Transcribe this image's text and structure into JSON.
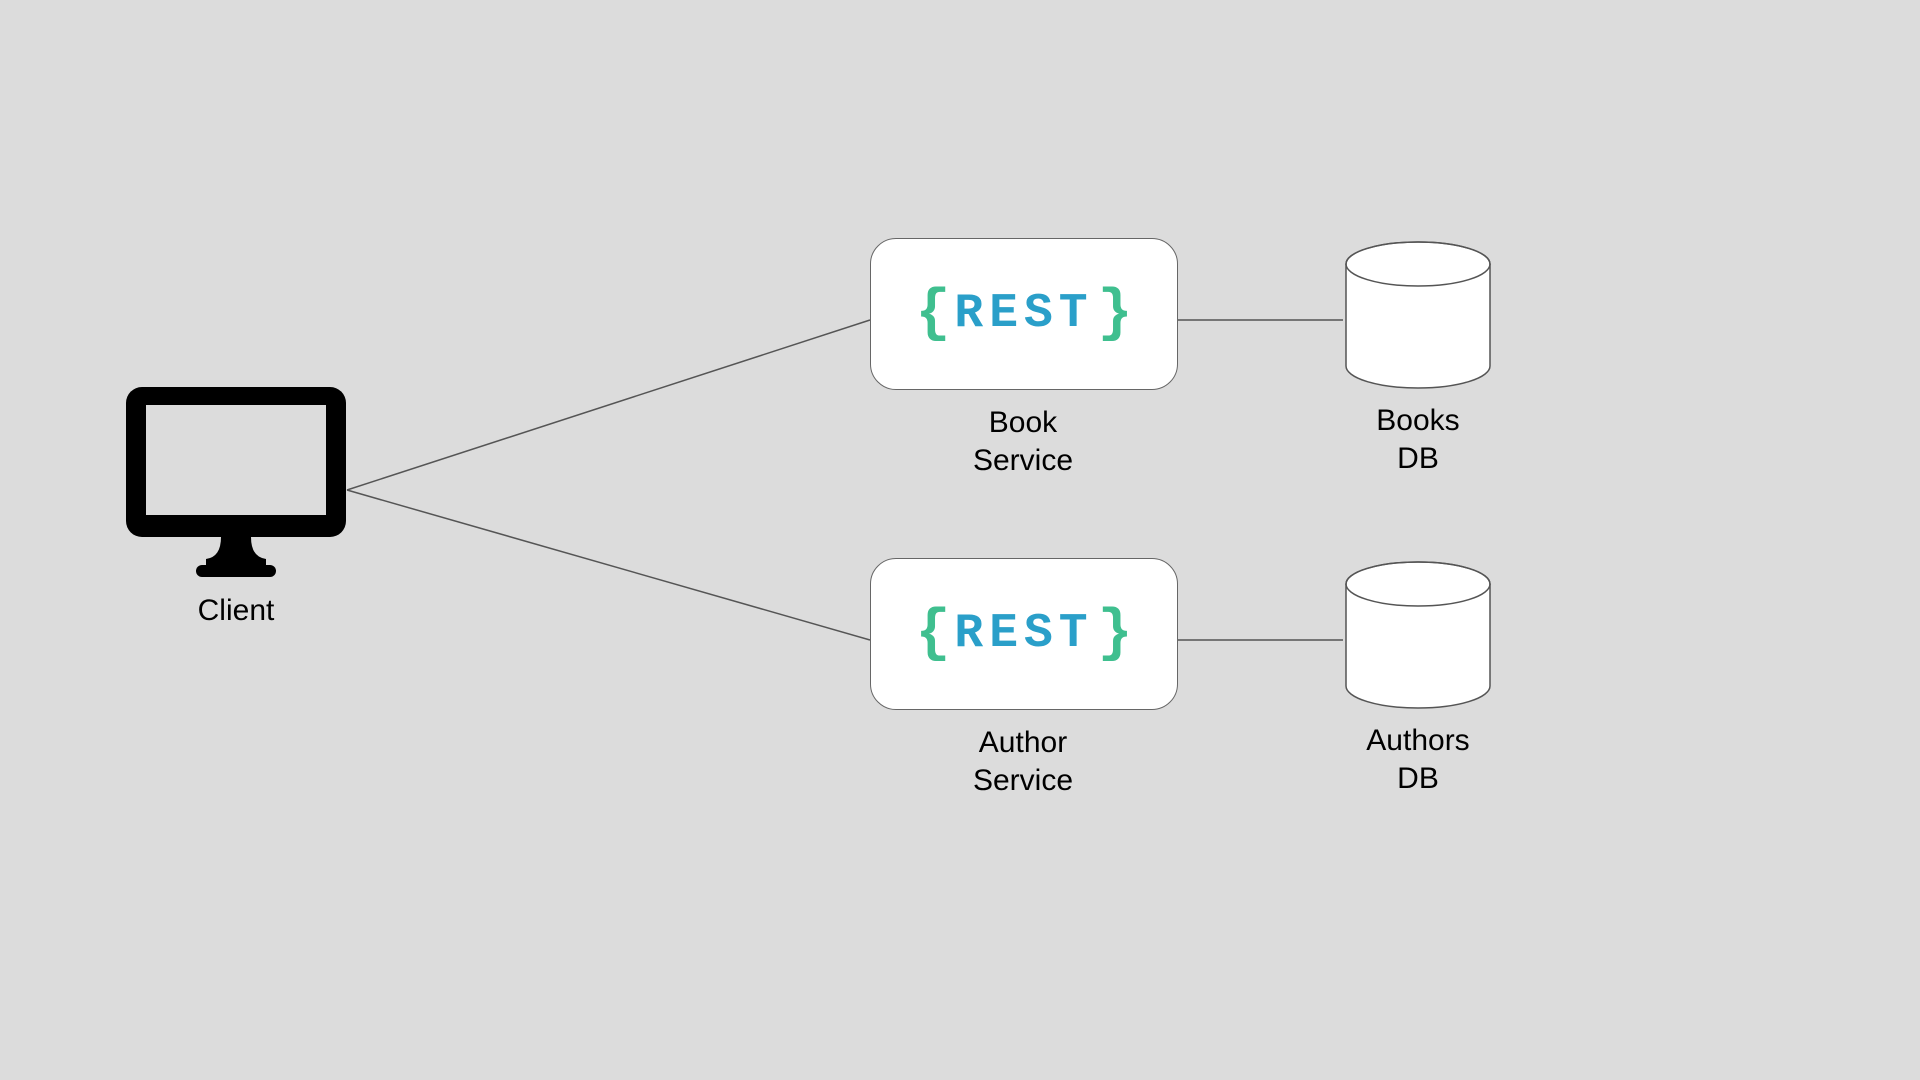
{
  "client": {
    "label": "Client"
  },
  "services": {
    "book": {
      "label": "Book\nService",
      "badge": "REST"
    },
    "author": {
      "label": "Author\nService",
      "badge": "REST"
    }
  },
  "databases": {
    "books": {
      "label": "Books\nDB"
    },
    "authors": {
      "label": "Authors\nDB"
    }
  },
  "colors": {
    "restText": "#2a9fc9",
    "brace": "#3fbf8f",
    "boxBorder": "#666666",
    "wire": "#555555",
    "bg": "#dcdcdc"
  }
}
